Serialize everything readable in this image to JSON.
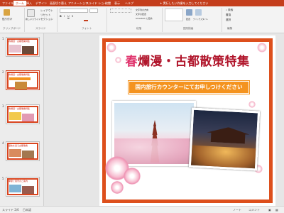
{
  "ribbon": {
    "tabs": [
      "ファイル",
      "ホーム",
      "挿入",
      "デザイン",
      "画面切り替え",
      "アニメーション",
      "スライド ショー",
      "校閲",
      "表示",
      "ヘルプ"
    ],
    "active_tab_index": 1,
    "search_text": "実行したい作業を入力してください",
    "clipboard": {
      "paste": "貼り付け",
      "group": "クリップボード"
    },
    "slides": {
      "new_slide": "新しいスライド",
      "layout": "レイアウト",
      "reset": "リセット",
      "section": "セクション",
      "group": "スライド"
    },
    "font": {
      "group": "フォント"
    },
    "paragraph": {
      "text_direction": "文字列の方向",
      "align_text": "文字の配置",
      "smartart": "SmartArt に変換",
      "group": "段落"
    },
    "drawing": {
      "shapes": "図形",
      "arrange": "配置",
      "quick_styles": "クイックスタイル",
      "group": "図形描画"
    },
    "editing": {
      "find": "検索",
      "replace": "置換",
      "select": "選択",
      "group": "編集"
    }
  },
  "thumbnails": [
    {
      "number": "1",
      "title": "春爛漫・古都散策特集",
      "selected": false
    },
    {
      "number": "2",
      "title": "春爛漫・古都散策特集",
      "selected": true
    },
    {
      "number": "3",
      "title": "春爛漫・古都散策特集",
      "selected": false
    },
    {
      "number": "4",
      "title": "歴史を巡る古都散策",
      "selected": false
    },
    {
      "number": "5",
      "title": "季節と風景のご案内",
      "selected": false
    }
  ],
  "slide": {
    "title_accent": "春",
    "title_rest": "爛漫・古都散策特集",
    "banner": "国内旅行カウンターにてお申しつけください"
  },
  "status": {
    "slide_counter": "スライド 2/6",
    "language": "日本語",
    "notes": "ノート",
    "comments": "コメント"
  },
  "colors": {
    "ribbon_accent": "#c43e1c",
    "frame": "#dd4f1c",
    "banner": "#f4931f",
    "title": "#b0142a"
  }
}
